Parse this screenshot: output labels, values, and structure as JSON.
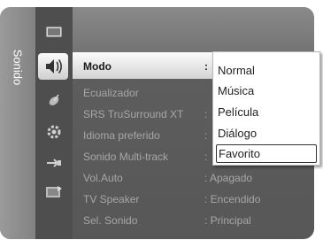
{
  "side_tab": {
    "label": "Sonido"
  },
  "icons": [
    "picture-icon",
    "sound-icon",
    "channel-icon",
    "setup-icon",
    "input-icon",
    "application-icon"
  ],
  "menu": {
    "items": [
      {
        "label": "Modo",
        "value": ":"
      },
      {
        "label": "Ecualizador",
        "value": ""
      },
      {
        "label": "SRS TruSurround XT",
        "value": ":"
      },
      {
        "label": "Idioma preferido",
        "value": ":"
      },
      {
        "label": "Sonido Multi-track",
        "value": ":"
      },
      {
        "label": "Vol.Auto",
        "value": ": Apagado"
      },
      {
        "label": "TV Speaker",
        "value": ": Encendido"
      },
      {
        "label": "Sel. Sonido",
        "value": ": Principal"
      }
    ],
    "active_index": 0
  },
  "dropdown": {
    "options": [
      "Normal",
      "Música",
      "Película",
      "Diálogo",
      "Favorito"
    ],
    "selected_index": 4
  }
}
